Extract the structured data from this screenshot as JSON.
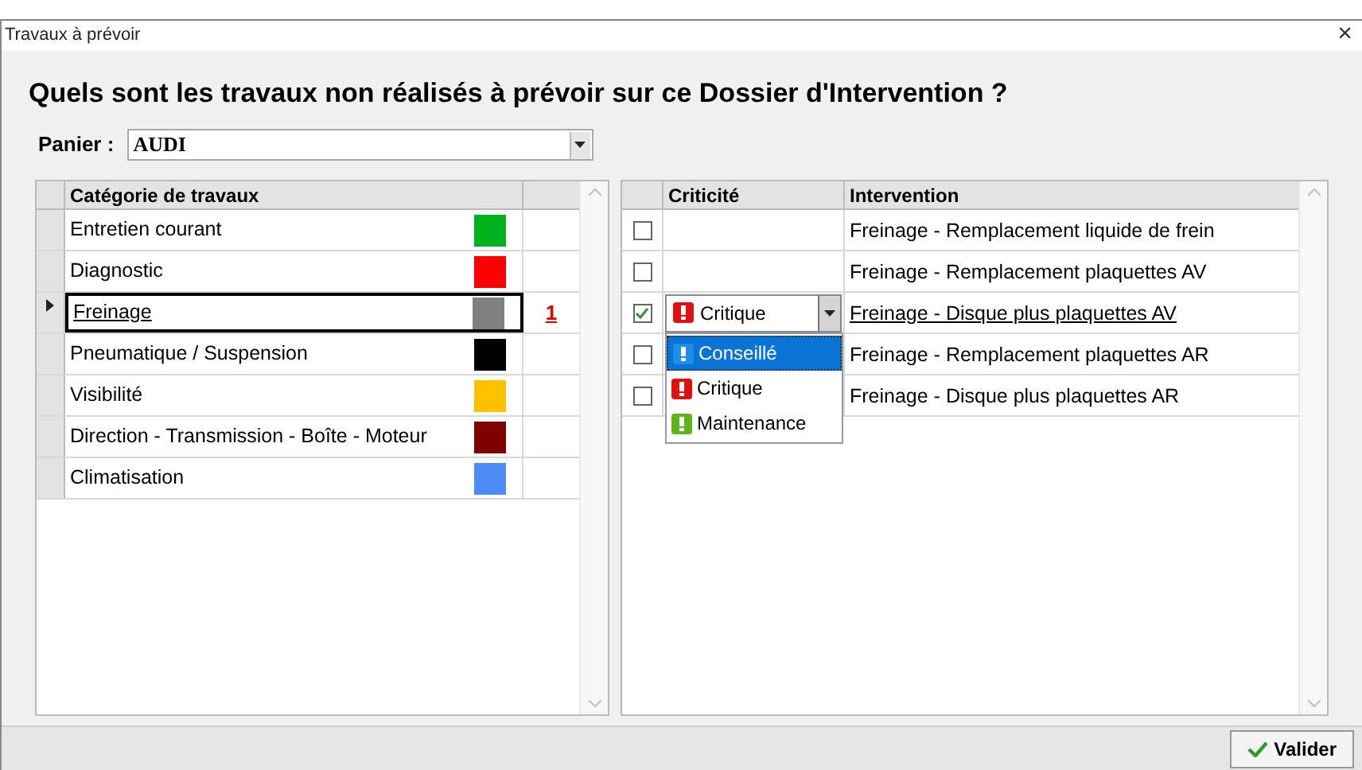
{
  "window": {
    "title": "Travaux à prévoir",
    "close": "×"
  },
  "heading": "Quels sont les travaux non réalisés à prévoir sur ce Dossier d'Intervention ?",
  "basket": {
    "label": "Panier :",
    "value": "AUDI"
  },
  "categories": {
    "columns": [
      "Catégorie de travaux"
    ],
    "rows": [
      {
        "name": "Entretien courant",
        "color": "#00b31e",
        "selected": false
      },
      {
        "name": "Diagnostic",
        "color": "#ff0000",
        "selected": false
      },
      {
        "name": "Freinage",
        "color": "#808080",
        "selected": true,
        "count": "1"
      },
      {
        "name": "Pneumatique / Suspension",
        "color": "#000000",
        "selected": false
      },
      {
        "name": "Visibilité",
        "color": "#ffc000",
        "selected": false
      },
      {
        "name": "Direction - Transmission - Boîte - Moteur",
        "color": "#7f0000",
        "selected": false
      },
      {
        "name": "Climatisation",
        "color": "#4d8cf5",
        "selected": false
      }
    ]
  },
  "interventions": {
    "columns": [
      "Criticité",
      "Intervention"
    ],
    "rows": [
      {
        "checked": false,
        "selected": false,
        "expanded": false,
        "intervention": "Freinage - Remplacement liquide de frein"
      },
      {
        "checked": false,
        "selected": false,
        "expanded": false,
        "intervention": "Freinage - Remplacement plaquettes AV"
      },
      {
        "checked": true,
        "selected": true,
        "expanded": true,
        "criticality": {
          "label": "Critique",
          "color": "#e01010"
        },
        "intervention": "Freinage - Disque plus plaquettes AV"
      },
      {
        "checked": false,
        "selected": false,
        "expanded": false,
        "intervention": "Freinage - Remplacement plaquettes AR"
      },
      {
        "checked": false,
        "selected": false,
        "expanded": false,
        "intervention": "Freinage - Disque plus plaquettes AR"
      }
    ],
    "dropdown": {
      "options": [
        {
          "label": "Conseillé",
          "color": "#1c8ee8",
          "selected": true
        },
        {
          "label": "Critique",
          "color": "#e01010",
          "selected": false
        },
        {
          "label": "Maintenance",
          "color": "#5fb41c",
          "selected": false
        }
      ]
    }
  },
  "button": {
    "label": "Valider"
  }
}
